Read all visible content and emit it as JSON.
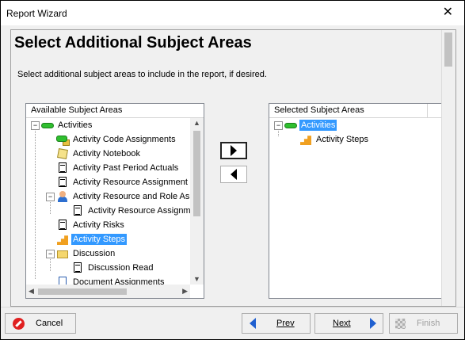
{
  "window": {
    "title": "Report Wizard",
    "close_glyph": "✕"
  },
  "page": {
    "heading": "Select Additional Subject Areas",
    "subtitle": "Select additional subject areas to include in the report, if desired."
  },
  "available": {
    "header": "Available Subject Areas",
    "items": [
      {
        "label": "Activities",
        "icon": "activity-pill-icon",
        "expander": "−"
      },
      {
        "label": "Activity Code Assignments",
        "icon": "activity-code-icon"
      },
      {
        "label": "Activity Notebook",
        "icon": "notebook-icon"
      },
      {
        "label": "Activity Past Period Actuals",
        "icon": "document-icon"
      },
      {
        "label": "Activity Resource Assignment",
        "icon": "document-icon"
      },
      {
        "label": "Activity Resource and Role As",
        "icon": "resource-person-icon",
        "expander": "−"
      },
      {
        "label": "Activity Resource Assignm",
        "icon": "document-icon"
      },
      {
        "label": "Activity Risks",
        "icon": "document-icon"
      },
      {
        "label": "Activity Steps",
        "icon": "steps-icon",
        "selected": true
      },
      {
        "label": "Discussion",
        "icon": "folder-icon",
        "expander": "−"
      },
      {
        "label": "Discussion Read",
        "icon": "document-icon"
      },
      {
        "label": "Document Assignments",
        "icon": "document-icon"
      }
    ]
  },
  "selected": {
    "header": "Selected Subject Areas",
    "items": [
      {
        "label": "Activities",
        "icon": "activity-pill-icon",
        "expander": "−",
        "selected": true
      },
      {
        "label": "Activity Steps",
        "icon": "steps-icon"
      }
    ]
  },
  "buttons": {
    "cancel": "Cancel",
    "prev": "Prev",
    "next": "Next",
    "finish": "Finish"
  }
}
